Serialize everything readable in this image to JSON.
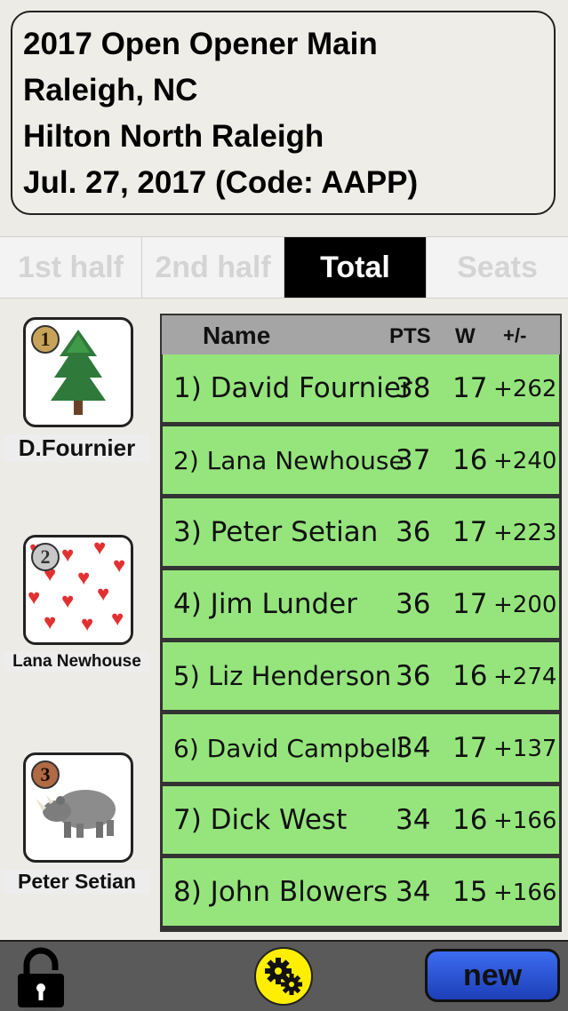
{
  "header": {
    "lines": [
      "2017 Open Opener Main",
      "Raleigh, NC",
      "Hilton North Raleigh",
      "Jul. 27, 2017 (Code: AAPP)"
    ]
  },
  "tabs": [
    "1st half",
    "2nd half",
    "Total",
    "Seats"
  ],
  "active_tab": "Total",
  "podium": [
    {
      "medal": "1",
      "name": "D.Fournier",
      "avatar": "tree-icon"
    },
    {
      "medal": "2",
      "name": "Lana Newhouse",
      "avatar": "hearts-icon"
    },
    {
      "medal": "3",
      "name": "Peter Setian",
      "avatar": "rhino-icon"
    }
  ],
  "table": {
    "columns": [
      "Name",
      "PTS",
      "W",
      "+/-"
    ],
    "rows": [
      {
        "name": "1) David Fournier",
        "pts": "38",
        "w": "17",
        "pm": "+262"
      },
      {
        "name": "2) Lana Newhouse",
        "pts": "37",
        "w": "16",
        "pm": "+240"
      },
      {
        "name": "3) Peter Setian",
        "pts": "36",
        "w": "17",
        "pm": "+223"
      },
      {
        "name": "4) Jim Lunder",
        "pts": "36",
        "w": "17",
        "pm": "+200"
      },
      {
        "name": "5) Liz Henderson",
        "pts": "36",
        "w": "16",
        "pm": "+274"
      },
      {
        "name": "6) David Campbell",
        "pts": "34",
        "w": "17",
        "pm": "+137"
      },
      {
        "name": "7) Dick West",
        "pts": "34",
        "w": "16",
        "pm": "+166"
      },
      {
        "name": "8) John Blowers",
        "pts": "34",
        "w": "15",
        "pm": "+166"
      }
    ]
  },
  "toolbar": {
    "new_label": "new",
    "lock_icon": "lock-icon",
    "settings_icon": "gears-icon"
  },
  "colors": {
    "row_bg": "#95e57c",
    "active_tab_bg": "#000000",
    "gear_bg": "#ffee00",
    "new_bg": "#2a52d6"
  }
}
